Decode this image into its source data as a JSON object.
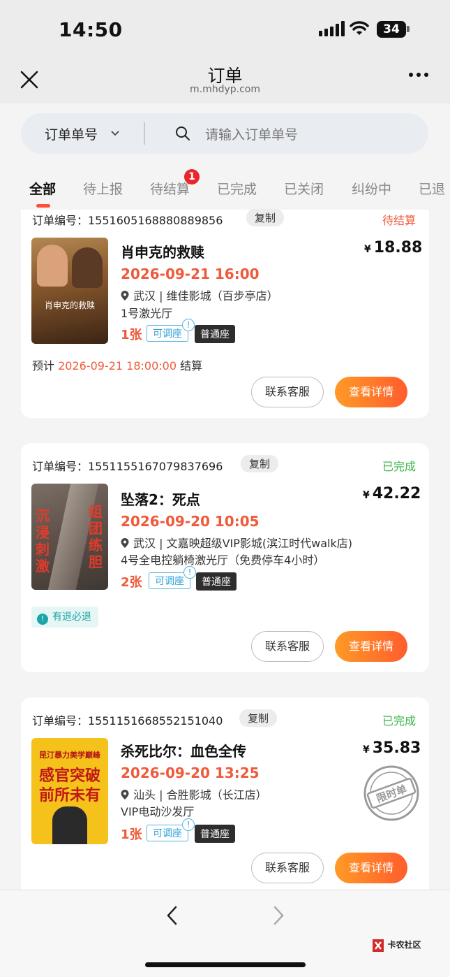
{
  "status_bar": {
    "time": "14:50",
    "battery": "34"
  },
  "nav": {
    "title": "订单",
    "url": "m.mhdyp.com"
  },
  "search": {
    "type_label": "订单单号",
    "placeholder": "请输入订单单号"
  },
  "tabs": [
    {
      "label": "全部",
      "active": true
    },
    {
      "label": "待上报"
    },
    {
      "label": "待结算",
      "badge": "1"
    },
    {
      "label": "已完成"
    },
    {
      "label": "已关闭"
    },
    {
      "label": "纠纷中"
    },
    {
      "label": "已退"
    }
  ],
  "orders": [
    {
      "order_no": "订单编号：1551605168880889856",
      "copy": "复制",
      "status": "待结算",
      "status_color": "#ef5a3b",
      "title": "肖申克的救赎",
      "price": "18.88",
      "currency": "¥",
      "showtime": "2026-09-21 16:00",
      "cinema": "武汉 | 维佳影城（百步亭店）",
      "hall": "1号激光厅",
      "qty": "1张",
      "adjustable": "可调座",
      "seat_type": "普通座",
      "estimate_prefix": "预计",
      "estimate_time": "2026-09-21 18:00:00",
      "estimate_suffix": "结算",
      "btn_service": "联系客服",
      "btn_detail": "查看详情"
    },
    {
      "order_no": "订单编号：1551155167079837696",
      "copy": "复制",
      "status": "已完成",
      "status_color": "#3bb54a",
      "title": "坠落2：死点",
      "price": "42.22",
      "currency": "¥",
      "showtime": "2026-09-20 10:05",
      "cinema": "武汉 | 文嘉映超级VIP影城(滨江时代walk店)",
      "hall": "4号全电控躺椅激光厅（免费停车4小时）",
      "qty": "2张",
      "adjustable": "可调座",
      "seat_type": "普通座",
      "refund_tag": "有退必退",
      "btn_service": "联系客服",
      "btn_detail": "查看详情"
    },
    {
      "order_no": "订单编号：1551151668552151040",
      "copy": "复制",
      "status": "已完成",
      "status_color": "#3bb54a",
      "title": "杀死比尔：血色全传",
      "price": "35.83",
      "currency": "¥",
      "showtime": "2026-09-20 13:25",
      "cinema": "汕头 | 合胜影城（长江店）",
      "hall": "VIP电动沙发厅",
      "qty": "1张",
      "adjustable": "可调座",
      "seat_type": "普通座",
      "stamp": "限时单",
      "btn_service": "联系客服",
      "btn_detail": "查看详情"
    }
  ],
  "posters": {
    "p1_text": "肖申克的救赎",
    "p2_left": "沉浸刺激",
    "p2_right": "组团练胆",
    "p3_top": "昆汀暴力美学巅峰",
    "p3_mid": "感官突破",
    "p3_mid2": "前所未有"
  },
  "watermark": "卡农社区",
  "accent_colors": {
    "primary": "#ff6a2b",
    "price_red": "#ef5a3b",
    "done_green": "#3bb54a"
  }
}
